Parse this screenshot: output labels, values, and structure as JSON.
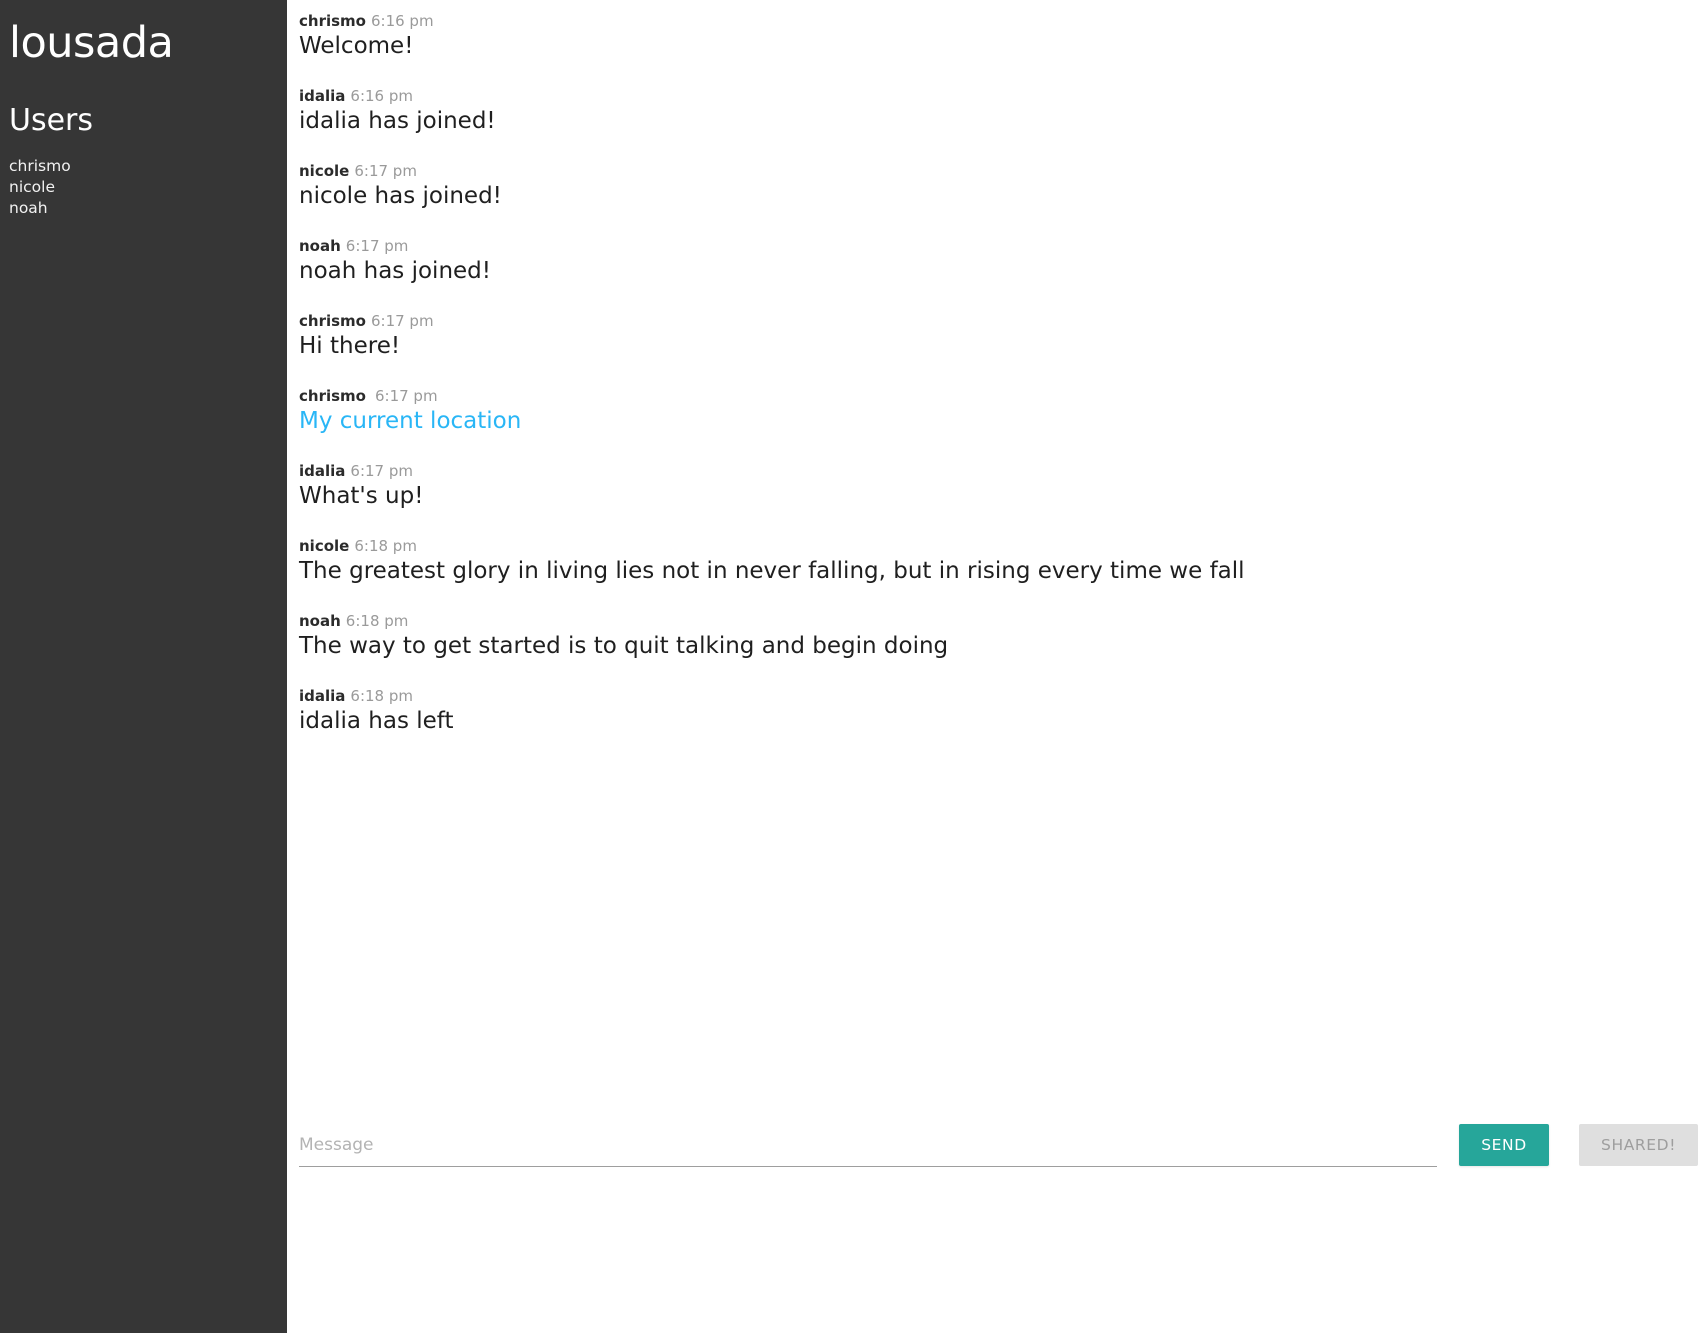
{
  "sidebar": {
    "title": "lousada",
    "users_heading": "Users",
    "users": [
      "chrismo",
      "nicole",
      "noah"
    ]
  },
  "chat": {
    "messages": [
      {
        "author": "chrismo",
        "time": "6:16 pm",
        "text": "Welcome!",
        "kind": "text"
      },
      {
        "author": "idalia",
        "time": "6:16 pm",
        "text": "idalia has joined!",
        "kind": "text"
      },
      {
        "author": "nicole",
        "time": "6:17 pm",
        "text": "nicole has joined!",
        "kind": "text"
      },
      {
        "author": "noah",
        "time": "6:17 pm",
        "text": "noah has joined!",
        "kind": "text"
      },
      {
        "author": "chrismo",
        "time": "6:17 pm",
        "text": "Hi there!",
        "kind": "text"
      },
      {
        "author": "chrismo",
        "time": "6:17 pm",
        "text": "My current location",
        "kind": "link"
      },
      {
        "author": "idalia",
        "time": "6:17 pm",
        "text": "What's up!",
        "kind": "text"
      },
      {
        "author": "nicole",
        "time": "6:18 pm",
        "text": "The greatest glory in living lies not in never falling, but in rising every time we fall",
        "kind": "text"
      },
      {
        "author": "noah",
        "time": "6:18 pm",
        "text": "The way to get started is to quit talking and begin doing",
        "kind": "text"
      },
      {
        "author": "idalia",
        "time": "6:18 pm",
        "text": "idalia has left",
        "kind": "text"
      }
    ]
  },
  "composer": {
    "input_value": "",
    "input_placeholder": "Message",
    "send_label": "Send",
    "shared_label": "Shared!"
  },
  "colors": {
    "sidebar_bg": "#363636",
    "accent_teal": "#26a69a",
    "link_blue": "#29b6f6",
    "disabled_bg": "#dfdfdf",
    "disabled_text": "#9e9e9e",
    "timestamp_gray": "#9a9a9a"
  }
}
